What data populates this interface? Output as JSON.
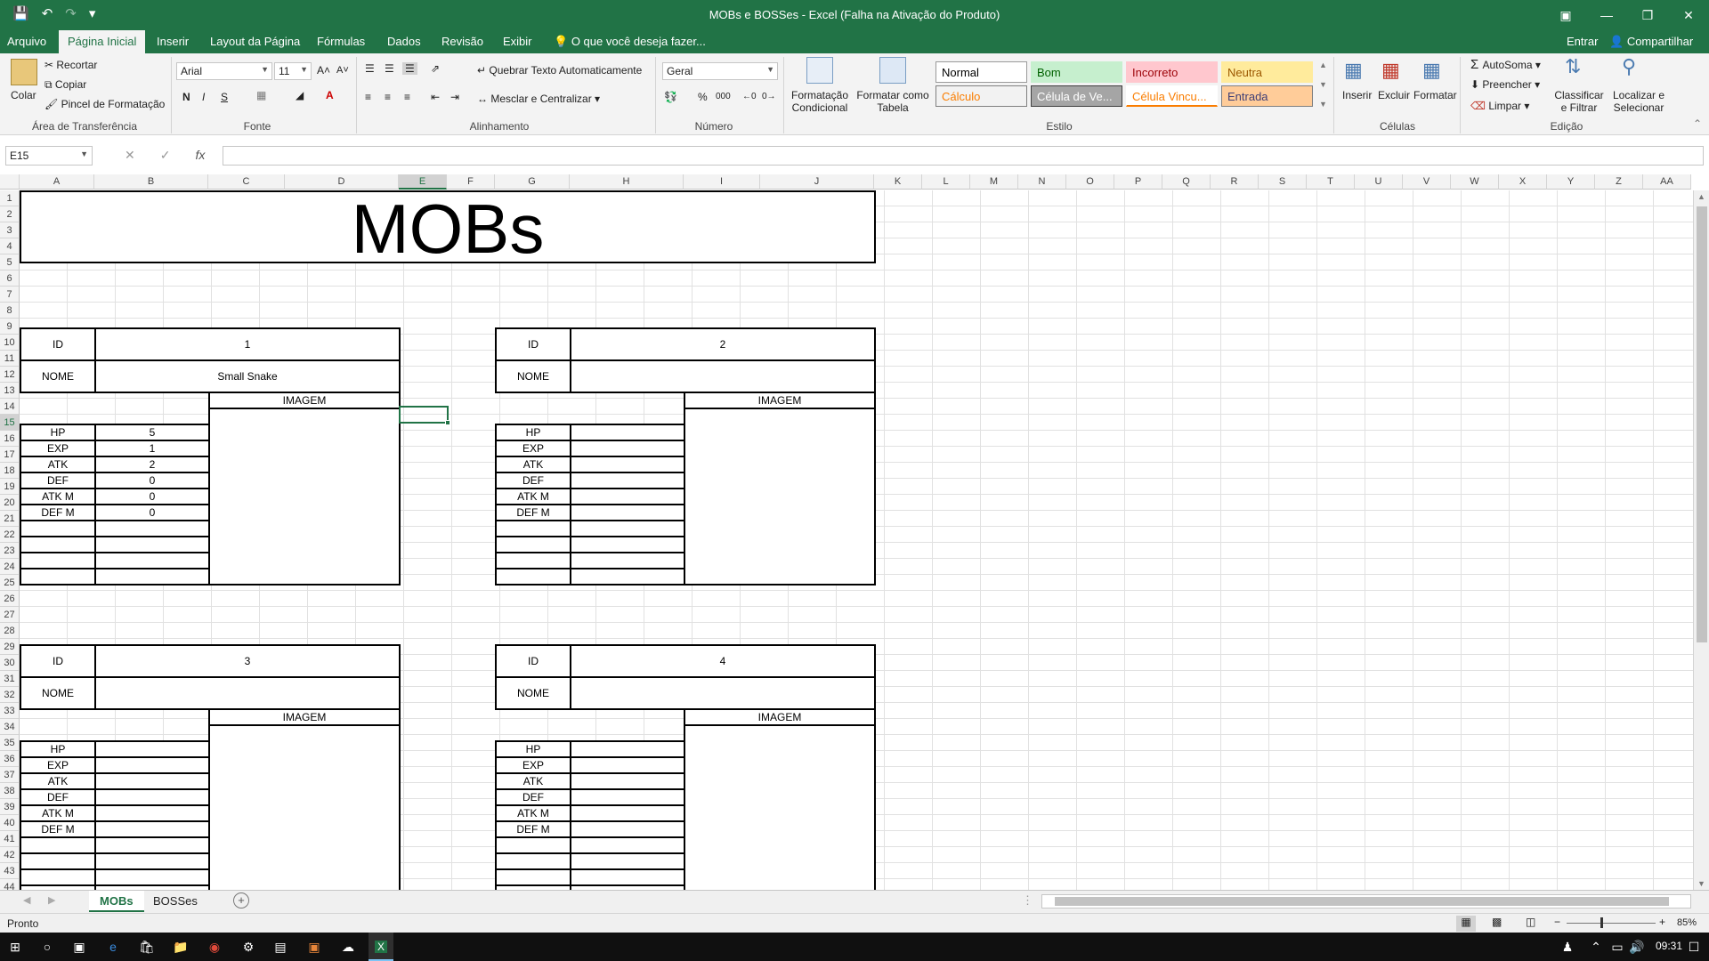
{
  "window": {
    "title": "MOBs e BOSSes - Excel (Falha na Ativação do Produto)",
    "qat_icons": [
      "save-icon",
      "undo-icon",
      "redo-icon",
      "customize-icon"
    ]
  },
  "menu": {
    "file": "Arquivo",
    "tabs": [
      "Página Inicial",
      "Inserir",
      "Layout da Página",
      "Fórmulas",
      "Dados",
      "Revisão",
      "Exibir"
    ],
    "tellme": "O que você deseja fazer...",
    "signin": "Entrar",
    "share": "Compartilhar"
  },
  "ribbon": {
    "clipboard": {
      "paste": "Colar",
      "cut": "Recortar",
      "copy": "Copiar",
      "painter": "Pincel de Formatação",
      "label": "Área de Transferência"
    },
    "font": {
      "family": "Arial",
      "size": "11",
      "label": "Fonte",
      "bold": "N",
      "italic": "I",
      "underline": "S"
    },
    "alignment": {
      "wrap": "Quebrar Texto Automaticamente",
      "merge": "Mesclar e Centralizar",
      "label": "Alinhamento"
    },
    "number": {
      "format": "Geral",
      "label": "Número",
      "percent": "%",
      "thousands": "000"
    },
    "styles": {
      "conditional": "Formatação Condicional",
      "astable": "Formatar como Tabela",
      "label": "Estilo",
      "cells": [
        {
          "name": "Normal",
          "bg": "#ffffff",
          "fg": "#000000",
          "border": "#9a9a9a"
        },
        {
          "name": "Bom",
          "bg": "#c6efce",
          "fg": "#006100",
          "border": "#c6efce"
        },
        {
          "name": "Incorreto",
          "bg": "#ffc7ce",
          "fg": "#9c0006",
          "border": "#ffc7ce"
        },
        {
          "name": "Neutra",
          "bg": "#ffeb9c",
          "fg": "#9c5700",
          "border": "#ffeb9c"
        },
        {
          "name": "Cálculo",
          "bg": "#f2f2f2",
          "fg": "#fa7d00",
          "border": "#7f7f7f"
        },
        {
          "name": "Célula de Ve...",
          "bg": "#a5a5a5",
          "fg": "#ffffff",
          "border": "#3f3f3f"
        },
        {
          "name": "Célula Vincu...",
          "bg": "#ffffff",
          "fg": "#fa7d00",
          "border": "#ffffff"
        },
        {
          "name": "Entrada",
          "bg": "#ffcc99",
          "fg": "#3f3f76",
          "border": "#7f7f7f"
        }
      ]
    },
    "cells": {
      "insert": "Inserir",
      "delete": "Excluir",
      "format": "Formatar",
      "label": "Células"
    },
    "editing": {
      "autosum": "AutoSoma",
      "fill": "Preencher",
      "clear": "Limpar",
      "sort": "Classificar e Filtrar",
      "find": "Localizar e Selecionar",
      "label": "Edição"
    }
  },
  "formula_bar": {
    "namebox": "E15",
    "fx": "fx",
    "value": ""
  },
  "columns": [
    "A",
    "B",
    "C",
    "D",
    "E",
    "F",
    "G",
    "H",
    "I",
    "J",
    "K",
    "L",
    "M",
    "N",
    "O",
    "P",
    "Q",
    "R",
    "S",
    "T",
    "U",
    "V",
    "W",
    "X",
    "Y",
    "Z",
    "AA"
  ],
  "selected_column": "E",
  "selected_row": 15,
  "sheet": {
    "title": "MOBs",
    "labels": {
      "id": "ID",
      "name": "NOME",
      "image": "IMAGEM",
      "hp": "HP",
      "exp": "EXP",
      "atk": "ATK",
      "def": "DEF",
      "atkm": "ATK M",
      "defm": "DEF M"
    },
    "mobs": [
      {
        "id": "1",
        "name": "Small Snake",
        "hp": "5",
        "exp": "1",
        "atk": "2",
        "def": "0",
        "atkm": "0",
        "defm": "0"
      },
      {
        "id": "2",
        "name": "",
        "hp": "",
        "exp": "",
        "atk": "",
        "def": "",
        "atkm": "",
        "defm": ""
      },
      {
        "id": "3",
        "name": "",
        "hp": "",
        "exp": "",
        "atk": "",
        "def": "",
        "atkm": "",
        "defm": ""
      },
      {
        "id": "4",
        "name": "",
        "hp": "",
        "exp": "",
        "atk": "",
        "def": "",
        "atkm": "",
        "defm": ""
      }
    ]
  },
  "sheet_tabs": [
    "MOBs",
    "BOSSes"
  ],
  "active_sheet": "MOBs",
  "status": {
    "text": "Pronto",
    "zoom": "85%"
  },
  "taskbar": {
    "time": "09:31"
  }
}
